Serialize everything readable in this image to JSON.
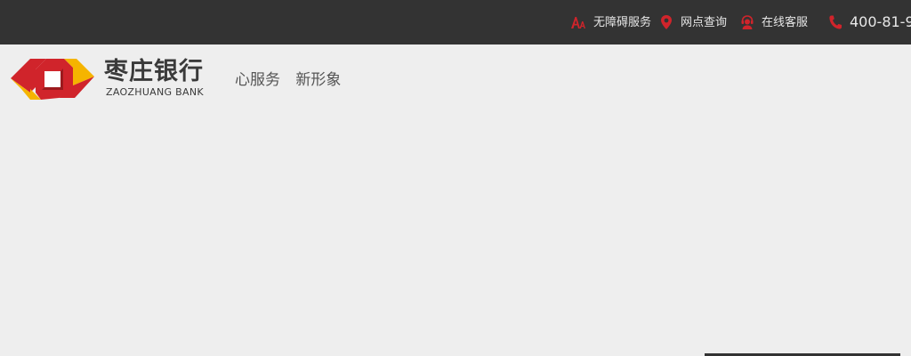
{
  "topbar": {
    "background": "#333333",
    "links": [
      {
        "label": "无障碍服务",
        "icon": "accessibility-icon"
      },
      {
        "label": "网点查询",
        "icon": "location-pin-icon"
      },
      {
        "label": "在线客服",
        "icon": "customer-service-icon"
      },
      {
        "label": "400-81-9",
        "icon": "phone-icon"
      }
    ],
    "icon_color": "#d0242b"
  },
  "header": {
    "logo": {
      "name_cn": "枣庄银行",
      "name_en": "ZAOZHUANG BANK",
      "colors": {
        "red": "#d0242b",
        "yellow": "#f5b400"
      }
    },
    "slogan": [
      "心服务",
      "新形象"
    ]
  },
  "page": {
    "background": "#eeeeee"
  }
}
